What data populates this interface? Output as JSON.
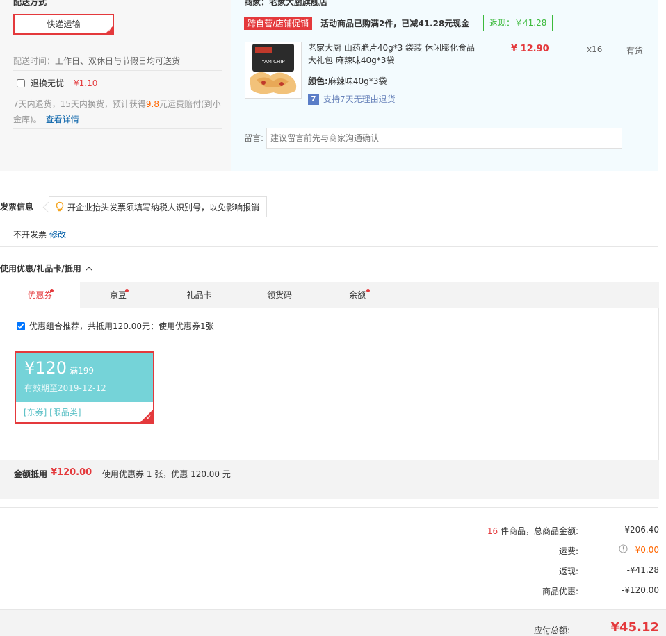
{
  "shipping": {
    "title": "配送方式",
    "method_button": "快递运输",
    "selected_tick": "✓",
    "time_label": "配送时间：",
    "time_value": "工作日、双休日与节假日均可送货",
    "return_service_label": "退换无忧",
    "return_service_price": "¥1.10",
    "return_desc_pre": "7天内退货，15天内换货，预计获得",
    "return_desc_amount": "9.8",
    "return_desc_post": "元运费赔付(到小金库)。",
    "return_details_link": "查看详情"
  },
  "shop": {
    "name": "商家：老家大厨旗舰店",
    "promo_tag": "跨自营/店铺促销",
    "promo_text": "活动商品已购满2件，已减41.28元现金",
    "cashback_tag": "返现：￥41.28",
    "product": {
      "name": "老家大厨 山药脆片40g*3 袋装 休闲膨化食品大礼包 麻辣味40g*3袋",
      "color_label": "颜色:",
      "color_value": "麻辣味40g*3袋",
      "support_icon_text": "7",
      "support_text": "支持7天无理由退货",
      "price": "¥ 12.90",
      "qty": "x16",
      "stock": "有货",
      "image_label": "YAM CHIP"
    },
    "note_label": "留言:",
    "note_placeholder": "建议留言前先与商家沟通确认"
  },
  "invoice": {
    "title": "发票信息",
    "tip": "开企业抬头发票须填写纳税人识别号，以免影响报销",
    "value": "不开发票",
    "modify_link": "修改"
  },
  "coupons": {
    "title": "使用优惠/礼品卡/抵用",
    "tabs": [
      {
        "label": "优惠券",
        "dot": true
      },
      {
        "label": "京豆",
        "dot": true
      },
      {
        "label": "礼品卡",
        "dot": false
      },
      {
        "label": "领货码",
        "dot": false
      },
      {
        "label": "余额",
        "dot": true
      }
    ],
    "combo_text": "优惠组合推荐，共抵用120.00元：使用优惠券1张",
    "coupon": {
      "amount": "¥120",
      "condition": "满199",
      "valid": "有效期至2019-12-12",
      "tags": "[东券]  [限品类]",
      "selected_tick": "✓"
    },
    "deduct_label": "金额抵用",
    "deduct_amount": "¥120.00",
    "deduct_desc": "使用优惠券 1 张，优惠 120.00 元"
  },
  "summary": {
    "count": "16",
    "count_label": " 件商品，总商品金额:",
    "goods_total": "¥206.40",
    "shipping_label": "运费:",
    "shipping_value": "¥0.00",
    "cashback_label": "返现:",
    "cashback_value": "-¥41.28",
    "discount_label": "商品优惠:",
    "discount_value": "-¥120.00",
    "payable_label": "应付总额:",
    "payable_value": "¥45.12"
  },
  "colors": {
    "accent": "#e4393c",
    "coupon_bg": "#75d3d8",
    "cashback_green": "#3cba3c",
    "link_blue": "#005ea7"
  }
}
